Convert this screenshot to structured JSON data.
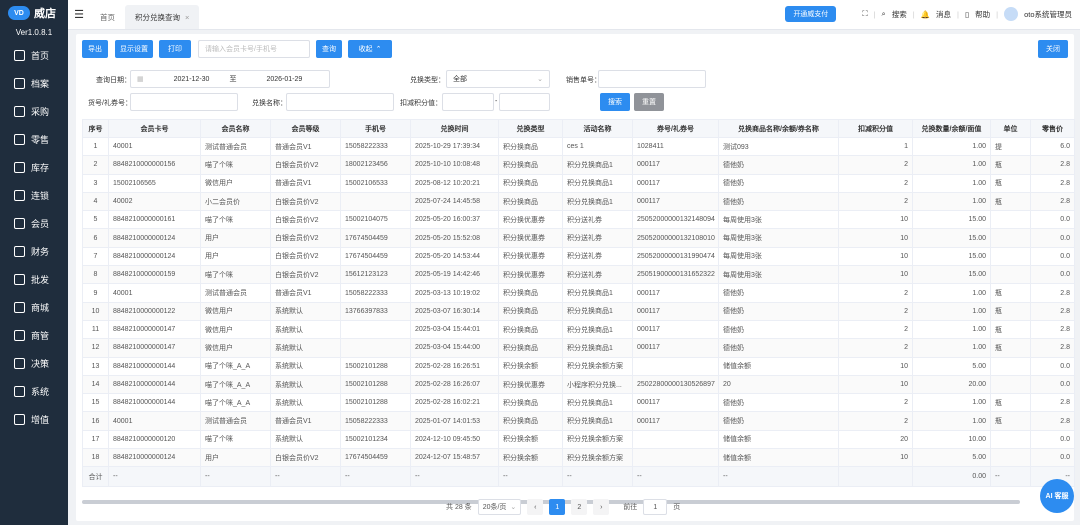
{
  "sidebar": {
    "logo_mark": "VD",
    "brand": "威店",
    "version": "Ver1.0.8.1",
    "items": [
      "首页",
      "档案",
      "采购",
      "零售",
      "库存",
      "连锁",
      "会员",
      "财务",
      "批发",
      "商城",
      "商管",
      "决策",
      "系统",
      "增值"
    ]
  },
  "tabs": [
    "首页",
    "积分兑换查询"
  ],
  "topbar": {
    "pay": "开通威支付",
    "search": "搜索",
    "msg": "消息",
    "help": "帮助",
    "user": "oto系统管理员"
  },
  "toolbar": {
    "export": "导出",
    "display": "显示设置",
    "print": "打印",
    "card_placeholder": "请输入会员卡号/手机号",
    "query": "查询",
    "collapse": "收起",
    "close": "关闭"
  },
  "filters": {
    "date_label": "查询日期：",
    "date_start": "2021-12-30",
    "date_to": "至",
    "date_end": "2026-01-29",
    "type_label": "兑换类型：",
    "type_value": "全部",
    "sale_no_label": "销售单号：",
    "voucher_label": "货号/礼券号：",
    "name_label": "兑换名称：",
    "points_label": "扣减积分值：",
    "range_dash": "-",
    "search": "搜索",
    "reset": "重置"
  },
  "table": {
    "headers": [
      "序号",
      "会员卡号",
      "会员名称",
      "会员等级",
      "手机号",
      "兑换时间",
      "兑换类型",
      "活动名称",
      "券号/礼券号",
      "兑换商品名称/余额/券名称",
      "扣减积分值",
      "兑换数量/余额/面值",
      "单位",
      "零售价"
    ],
    "rows": [
      [
        "1",
        "40001",
        "测试普通会员",
        "普通会员V1",
        "15058222333",
        "2025-10-29 17:39:34",
        "积分换商品",
        "ces 1",
        "1028411",
        "测试093",
        "1",
        "1.00",
        "提",
        "6.0"
      ],
      [
        "2",
        "8848210000000156",
        "喵了个咪",
        "白银会员价V2",
        "18002123456",
        "2025-10-10 10:08:48",
        "积分换商品",
        "积分兑换商品1",
        "000117",
        "德他奶",
        "2",
        "1.00",
        "瓶",
        "2.8"
      ],
      [
        "3",
        "15002106565",
        "微信用户",
        "普通会员V1",
        "15002106533",
        "2025-08-12 10:20:21",
        "积分换商品",
        "积分兑换商品1",
        "000117",
        "德他奶",
        "2",
        "1.00",
        "瓶",
        "2.8"
      ],
      [
        "4",
        "40002",
        "小二会员价",
        "白银会员价V2",
        "",
        "2025-07-24 14:45:58",
        "积分换商品",
        "积分兑换商品1",
        "000117",
        "德他奶",
        "2",
        "1.00",
        "瓶",
        "2.8"
      ],
      [
        "5",
        "8848210000000161",
        "喵了个咪",
        "白银会员价V2",
        "15002104075",
        "2025-05-20 16:00:37",
        "积分换优惠券",
        "积分送礼券",
        "25052000000132148094",
        "每周使用3张",
        "10",
        "15.00",
        "",
        "0.0"
      ],
      [
        "6",
        "8848210000000124",
        "用户",
        "白银会员价V2",
        "17674504459",
        "2025-05-20 15:52:08",
        "积分换优惠券",
        "积分送礼券",
        "25052000000132108010",
        "每周使用3张",
        "10",
        "15.00",
        "",
        "0.0"
      ],
      [
        "7",
        "8848210000000124",
        "用户",
        "白银会员价V2",
        "17674504459",
        "2025-05-20 14:53:44",
        "积分换优惠券",
        "积分送礼券",
        "25052000000131990474",
        "每周使用3张",
        "10",
        "15.00",
        "",
        "0.0"
      ],
      [
        "8",
        "8848210000000159",
        "喵了个咪",
        "白银会员价V2",
        "15612123123",
        "2025-05-19 14:42:46",
        "积分换优惠券",
        "积分送礼券",
        "25051900000131652322",
        "每周使用3张",
        "10",
        "15.00",
        "",
        "0.0"
      ],
      [
        "9",
        "40001",
        "测试普通会员",
        "普通会员V1",
        "15058222333",
        "2025-03-13 10:19:02",
        "积分换商品",
        "积分兑换商品1",
        "000117",
        "德他奶",
        "2",
        "1.00",
        "瓶",
        "2.8"
      ],
      [
        "10",
        "8848210000000122",
        "微信用户",
        "系统默认",
        "13766397833",
        "2025-03-07 16:30:14",
        "积分换商品",
        "积分兑换商品1",
        "000117",
        "德他奶",
        "2",
        "1.00",
        "瓶",
        "2.8"
      ],
      [
        "11",
        "8848210000000147",
        "微信用户",
        "系统默认",
        "",
        "2025-03-04 15:44:01",
        "积分换商品",
        "积分兑换商品1",
        "000117",
        "德他奶",
        "2",
        "1.00",
        "瓶",
        "2.8"
      ],
      [
        "12",
        "8848210000000147",
        "微信用户",
        "系统默认",
        "",
        "2025-03-04 15:44:00",
        "积分换商品",
        "积分兑换商品1",
        "000117",
        "德他奶",
        "2",
        "1.00",
        "瓶",
        "2.8"
      ],
      [
        "13",
        "8848210000000144",
        "喵了个咪_A_A",
        "系统默认",
        "15002101288",
        "2025-02-28 16:26:51",
        "积分换余额",
        "积分兑换余额方案",
        "",
        "储值余额",
        "10",
        "5.00",
        "",
        "0.0"
      ],
      [
        "14",
        "8848210000000144",
        "喵了个咪_A_A",
        "系统默认",
        "15002101288",
        "2025-02-28 16:26:07",
        "积分换优惠券",
        "小程序积分兑换...",
        "25022800000130526897",
        "20",
        "10",
        "20.00",
        "",
        "0.0"
      ],
      [
        "15",
        "8848210000000144",
        "喵了个咪_A_A",
        "系统默认",
        "15002101288",
        "2025-02-28 16:02:21",
        "积分换商品",
        "积分兑换商品1",
        "000117",
        "德他奶",
        "2",
        "1.00",
        "瓶",
        "2.8"
      ],
      [
        "16",
        "40001",
        "测试普通会员",
        "普通会员V1",
        "15058222333",
        "2025-01-07 14:01:53",
        "积分换商品",
        "积分兑换商品1",
        "000117",
        "德他奶",
        "2",
        "1.00",
        "瓶",
        "2.8"
      ],
      [
        "17",
        "8848210000000120",
        "喵了个咪",
        "系统默认",
        "15002101234",
        "2024-12-10 09:45:50",
        "积分换余额",
        "积分兑换余额方案",
        "",
        "储值余额",
        "20",
        "10.00",
        "",
        "0.0"
      ],
      [
        "18",
        "8848210000000124",
        "用户",
        "白银会员价V2",
        "17674504459",
        "2024-12-07 15:48:57",
        "积分换余额",
        "积分兑换余额方案",
        "",
        "储值余额",
        "10",
        "5.00",
        "",
        "0.0"
      ]
    ],
    "footer": [
      "合计",
      "--",
      "--",
      "--",
      "--",
      "--",
      "--",
      "--",
      "--",
      "--",
      "",
      "0.00",
      "--",
      "--"
    ]
  },
  "pager": {
    "total": "共 28 条",
    "size": "20条/页",
    "prev": "‹",
    "p1": "1",
    "p2": "2",
    "next": "›",
    "goto": "前往",
    "page": "1",
    "page_unit": "页"
  },
  "ai": "AI 客服"
}
